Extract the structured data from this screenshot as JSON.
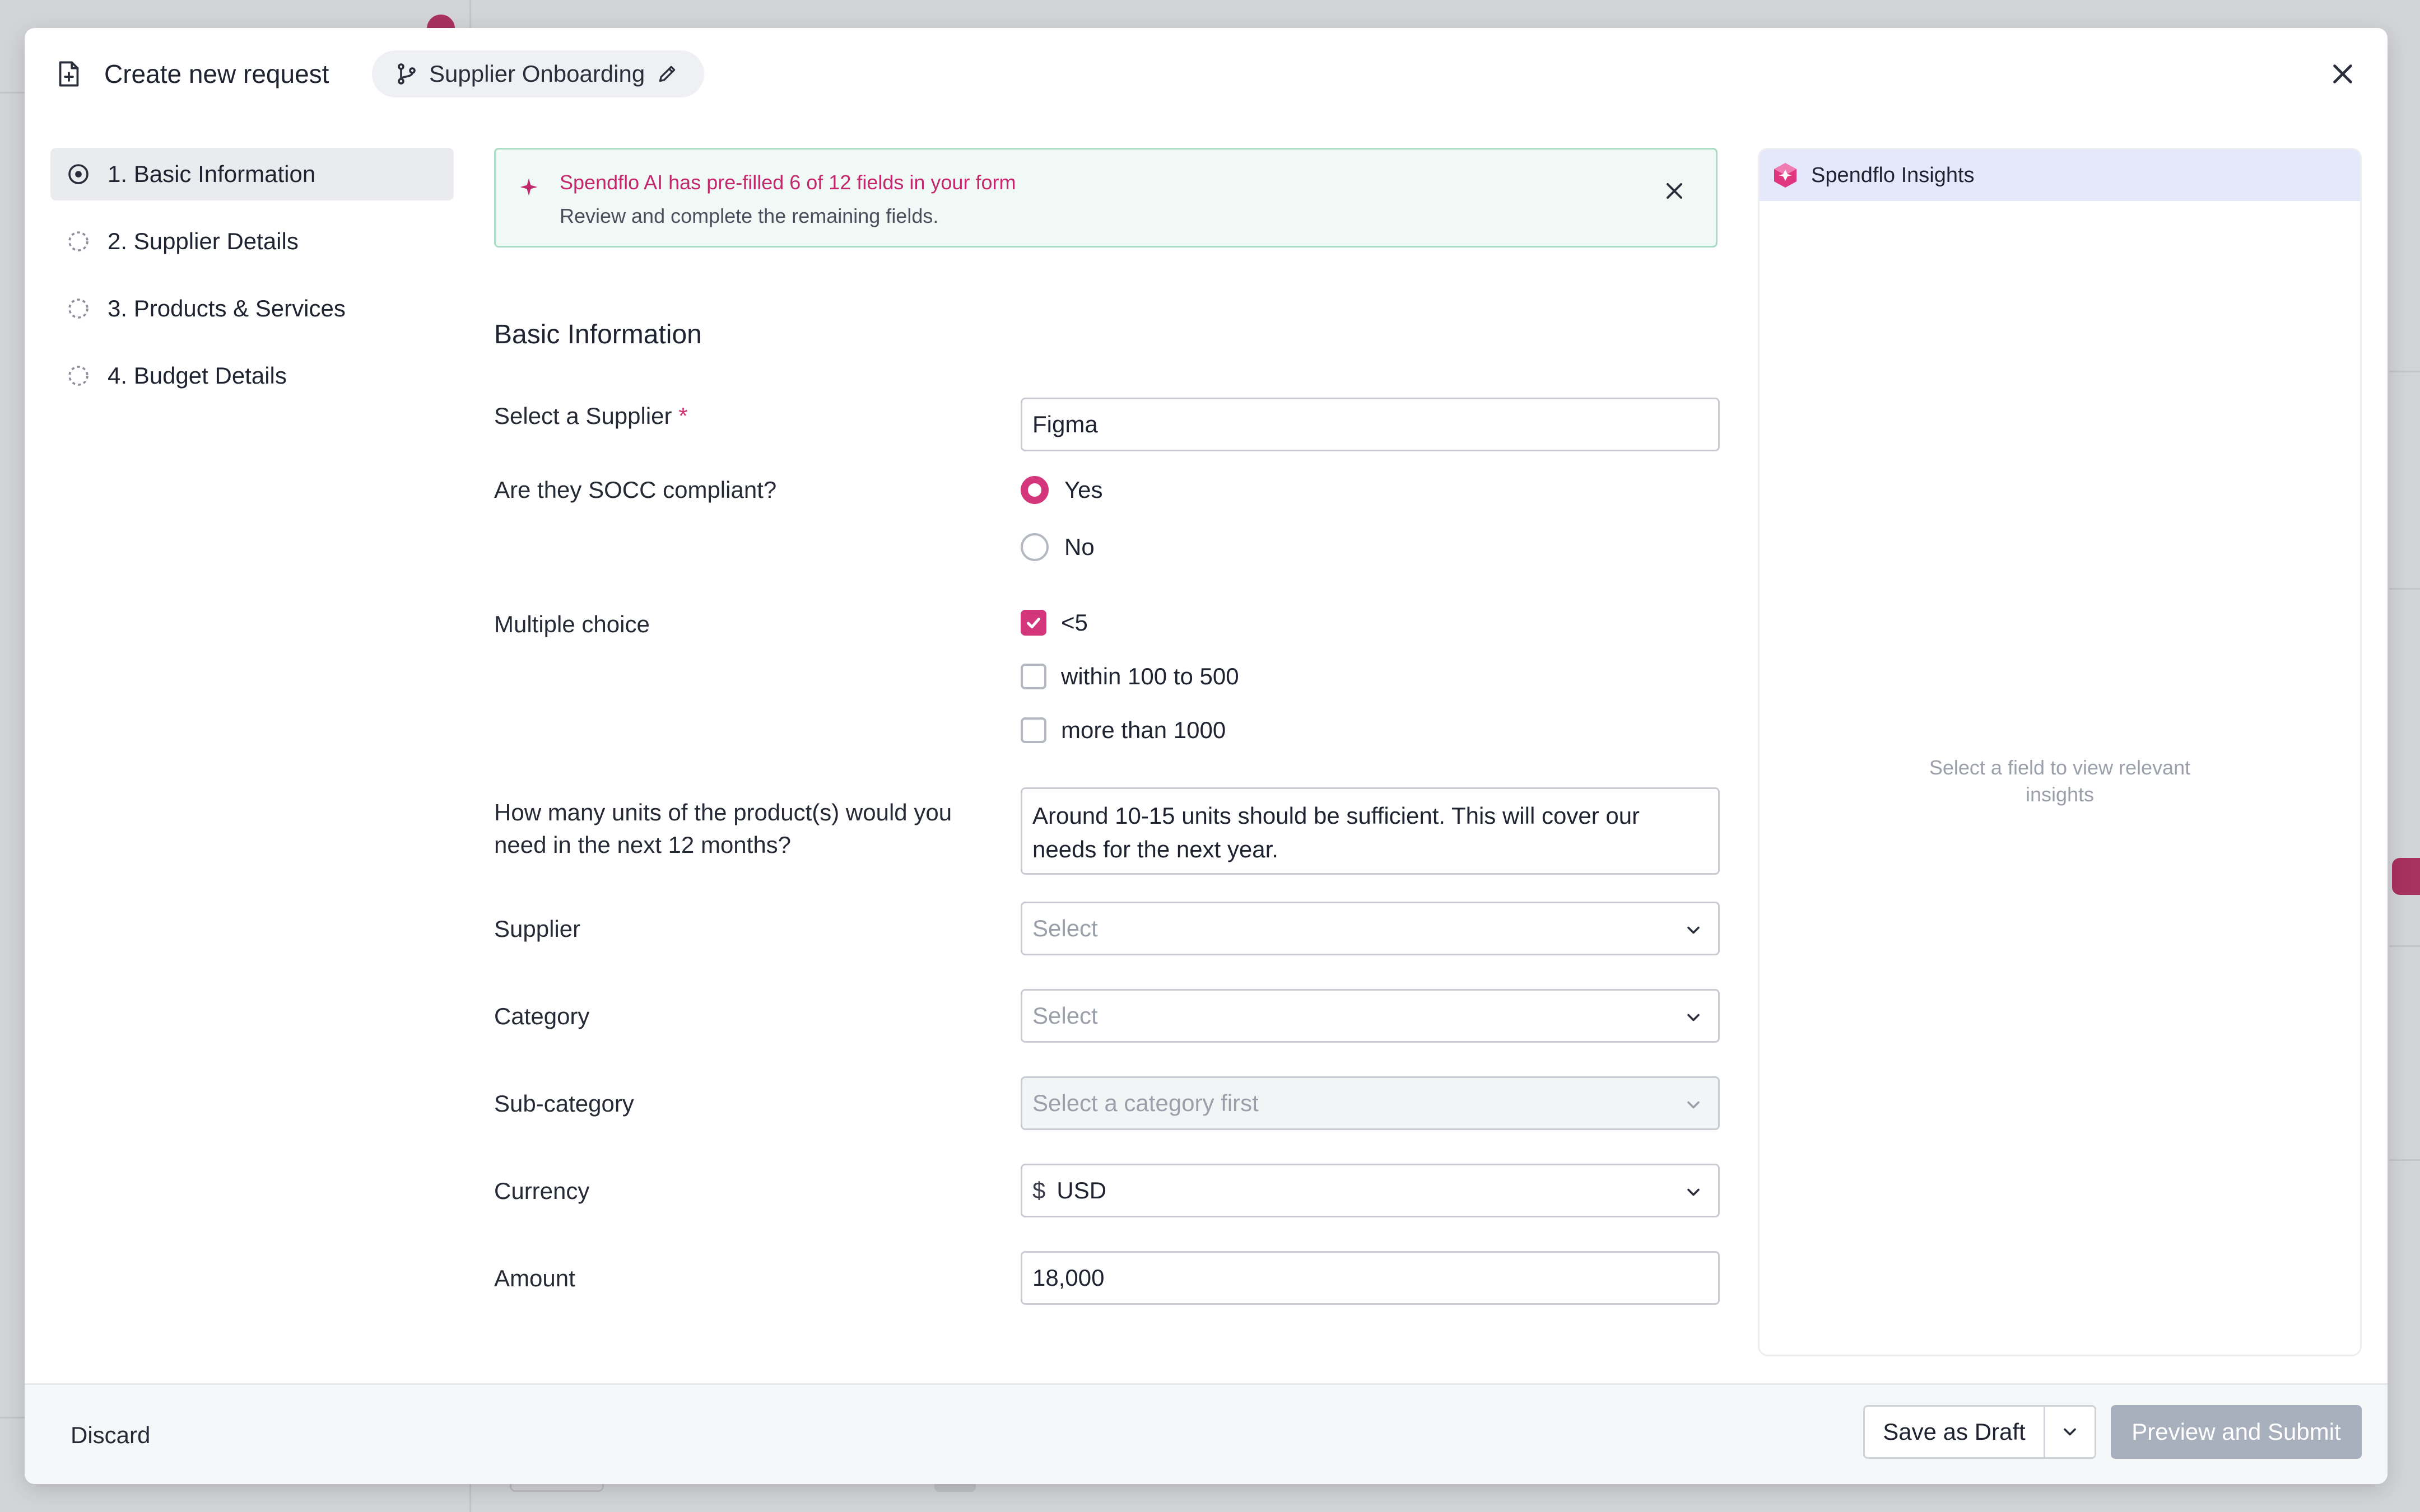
{
  "modal": {
    "title": "Create new request",
    "workflow_name": "Supplier Onboarding"
  },
  "nav": {
    "items": [
      {
        "label": "1. Basic Information",
        "active": true
      },
      {
        "label": "2. Supplier Details",
        "active": false
      },
      {
        "label": "3. Products & Services",
        "active": false
      },
      {
        "label": "4. Budget Details",
        "active": false
      }
    ]
  },
  "banner": {
    "title": "Spendflo AI has pre-filled 6 of 12 fields in your form",
    "subtitle": "Review and complete the remaining fields."
  },
  "form": {
    "section_title": "Basic Information",
    "select_supplier": {
      "label": "Select a Supplier",
      "required_mark": "*",
      "value": "Figma"
    },
    "socc": {
      "label": "Are they SOCC compliant?",
      "options": [
        {
          "label": "Yes",
          "selected": true
        },
        {
          "label": "No",
          "selected": false
        }
      ]
    },
    "multiple_choice": {
      "label": "Multiple choice",
      "options": [
        {
          "label": "<5",
          "checked": true
        },
        {
          "label": "within 100 to 500",
          "checked": false
        },
        {
          "label": "more than 1000",
          "checked": false
        }
      ]
    },
    "units": {
      "label": "How many units of the product(s) would you need in the next 12 months?",
      "value": "Around 10-15 units should be sufficient. This will cover our needs for the next year."
    },
    "supplier": {
      "label": "Supplier",
      "placeholder": "Select"
    },
    "category": {
      "label": "Category",
      "placeholder": "Select"
    },
    "subcategory": {
      "label": "Sub-category",
      "placeholder": "Select a category first"
    },
    "currency": {
      "label": "Currency",
      "symbol": "$",
      "value": "USD"
    },
    "amount": {
      "label": "Amount",
      "value": "18,000"
    }
  },
  "insights": {
    "title": "Spendflo Insights",
    "empty_text": "Select a field to view relevant insights"
  },
  "footer": {
    "discard_label": "Discard",
    "save_draft_label": "Save as Draft",
    "submit_label": "Preview and Submit"
  },
  "colors": {
    "accent": "#d3367a",
    "banner_bg": "#f1f9f6",
    "insights_header_bg": "#e5e7fb",
    "submit_disabled": "#a9b0bd"
  }
}
